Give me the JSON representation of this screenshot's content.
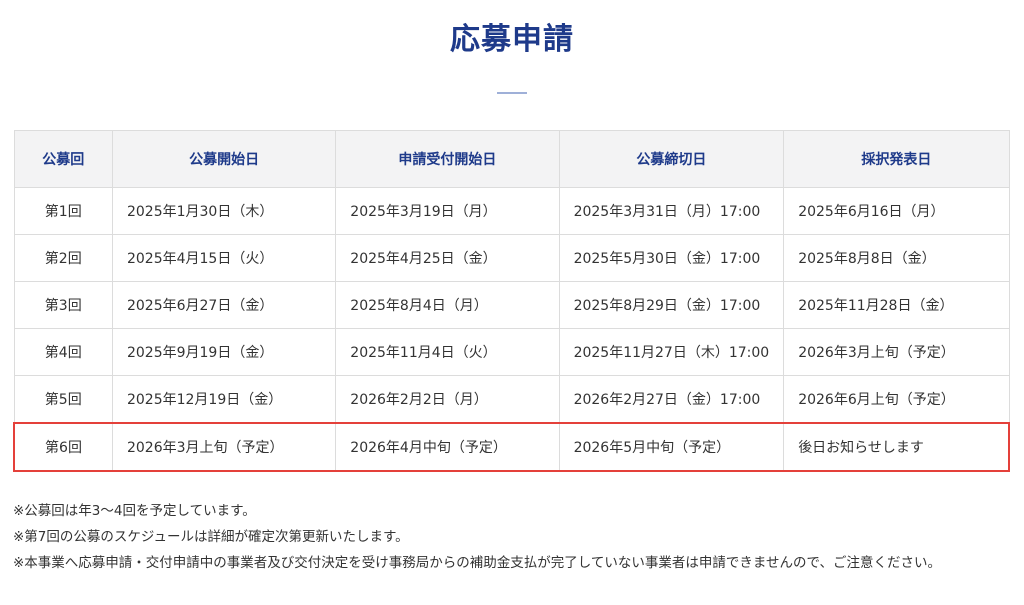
{
  "page": {
    "title": "応募申請"
  },
  "table": {
    "headers": [
      "公募回",
      "公募開始日",
      "申請受付開始日",
      "公募締切日",
      "採択発表日"
    ],
    "rows": [
      [
        "第1回",
        "2025年1月30日（木）",
        "2025年3月19日（月）",
        "2025年3月31日（月）17:00",
        "2025年6月16日（月）"
      ],
      [
        "第2回",
        "2025年4月15日（火）",
        "2025年4月25日（金）",
        "2025年5月30日（金）17:00",
        "2025年8月8日（金）"
      ],
      [
        "第3回",
        "2025年6月27日（金）",
        "2025年8月4日（月）",
        "2025年8月29日（金）17:00",
        "2025年11月28日（金）"
      ],
      [
        "第4回",
        "2025年9月19日（金）",
        "2025年11月4日（火）",
        "2025年11月27日（木）17:00",
        "2026年3月上旬（予定）"
      ],
      [
        "第5回",
        "2025年12月19日（金）",
        "2026年2月2日（月）",
        "2026年2月27日（金）17:00",
        "2026年6月上旬（予定）"
      ],
      [
        "第6回",
        "2026年3月上旬（予定）",
        "2026年4月中旬（予定）",
        "2026年5月中旬（予定）",
        "後日お知らせします"
      ]
    ],
    "highlight_color": "#e4403a"
  },
  "notes": [
    "※公募回は年3〜4回を予定しています。",
    "※第7回の公募のスケジュールは詳細が確定次第更新いたします。",
    "※本事業へ応募申請・交付申請中の事業者及び交付決定を受け事務局からの補助金支払が完了していない事業者は申請できませんので、ご注意ください。"
  ],
  "colors": {
    "heading": "#1e3a8a",
    "header_bg": "#f3f3f4",
    "border": "#dcdcdc"
  }
}
